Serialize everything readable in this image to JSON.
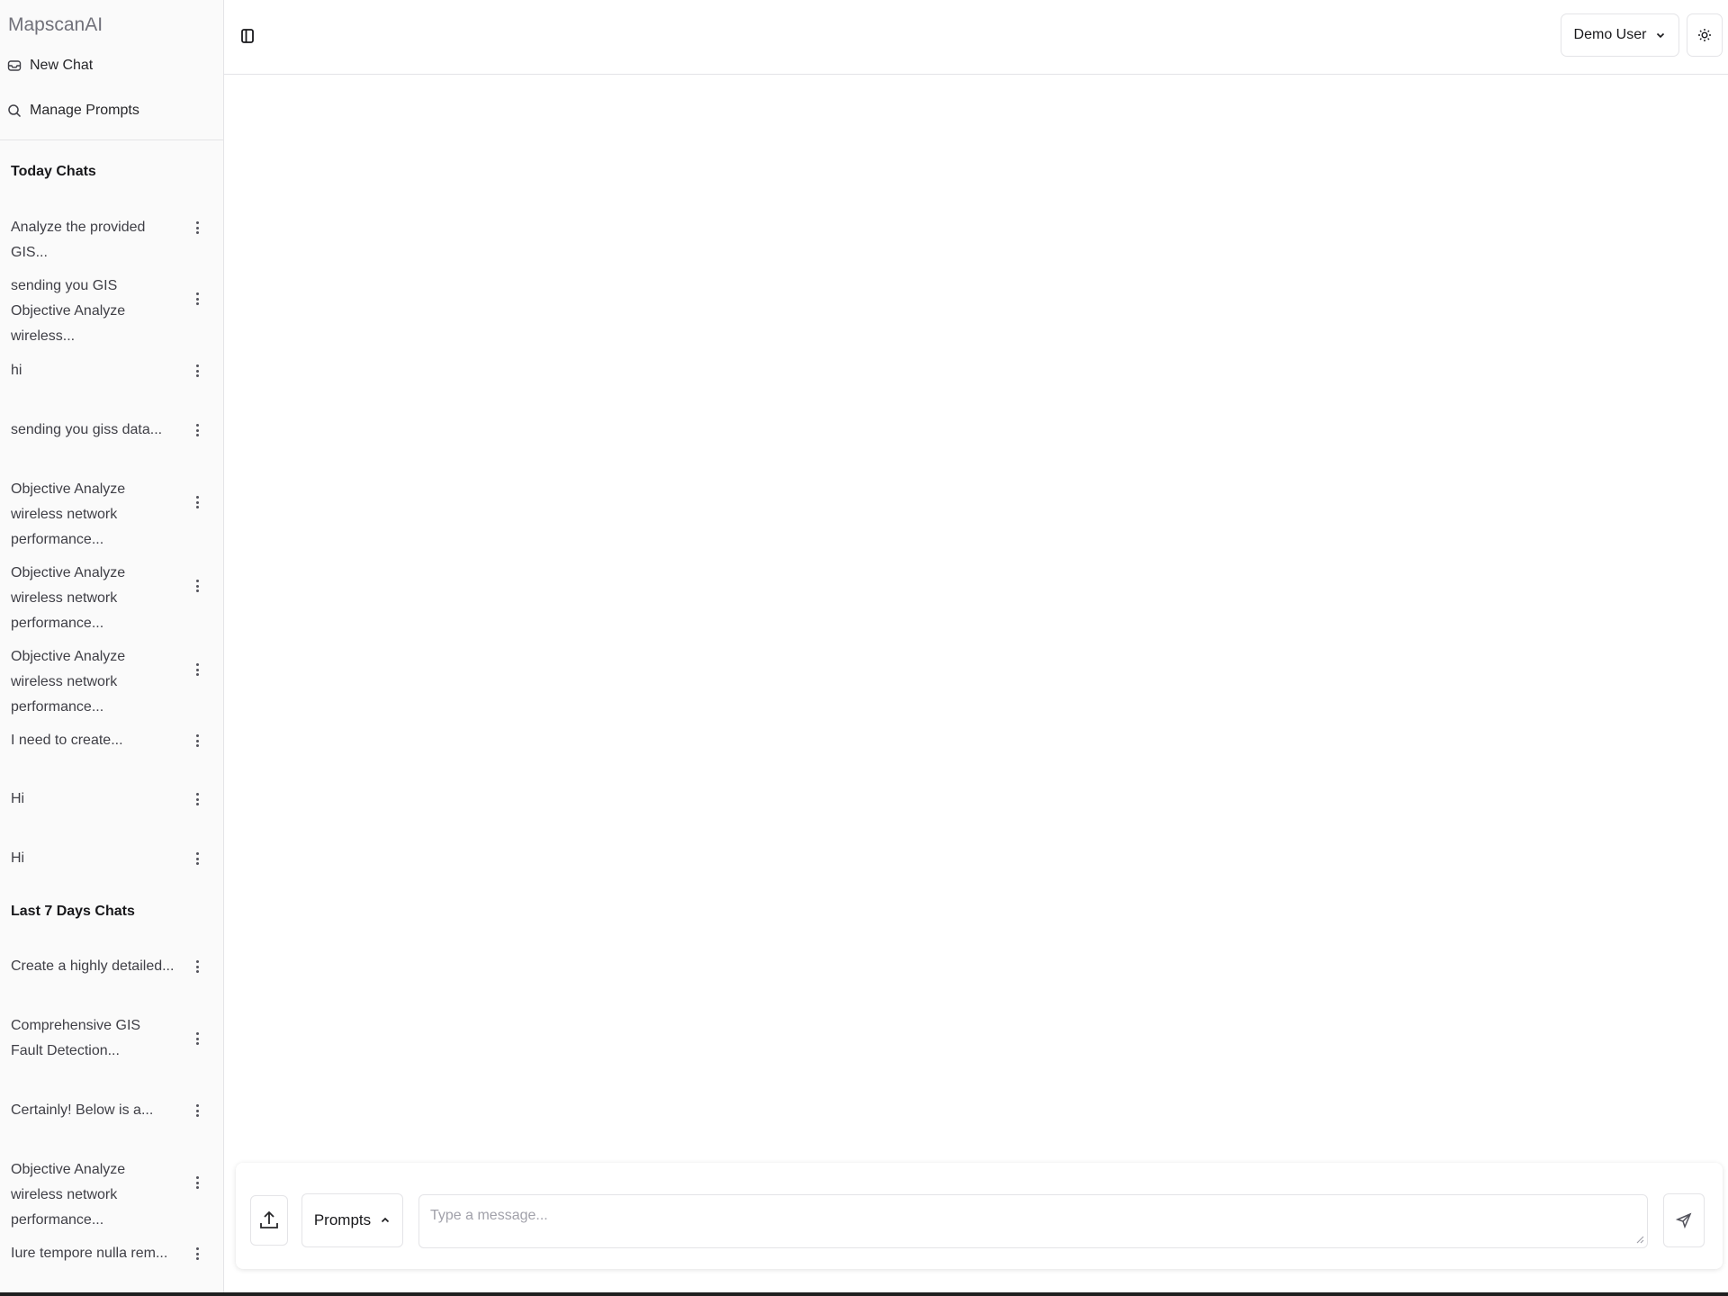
{
  "app": {
    "brand": "MapscanAI"
  },
  "sidebar": {
    "new_chat_label": "New Chat",
    "manage_prompts_label": "Manage Prompts",
    "sections": [
      {
        "title": "Today Chats",
        "items": [
          "Analyze the provided GIS...",
          "sending you GIS Objective Analyze wireless...",
          "hi",
          "sending you giss data...",
          "Objective Analyze wireless network performance...",
          "Objective Analyze wireless network performance...",
          "Objective Analyze wireless network performance...",
          "I need to create...",
          "Hi",
          "Hi"
        ]
      },
      {
        "title": "Last 7 Days Chats",
        "items": [
          "Create a highly detailed...",
          "Comprehensive GIS Fault Detection...",
          "Certainly! Below is a...",
          "Objective Analyze wireless network performance...",
          "Iure tempore nulla rem..."
        ]
      }
    ]
  },
  "header": {
    "user_label": "Demo User",
    "icons": [
      "panel-toggle-icon",
      "chevron-down-icon",
      "sun-icon"
    ]
  },
  "composer": {
    "prompts_label": "Prompts",
    "placeholder": "Type a message...",
    "value": "",
    "icons": [
      "upload-icon",
      "chevron-up-icon",
      "send-icon"
    ]
  }
}
